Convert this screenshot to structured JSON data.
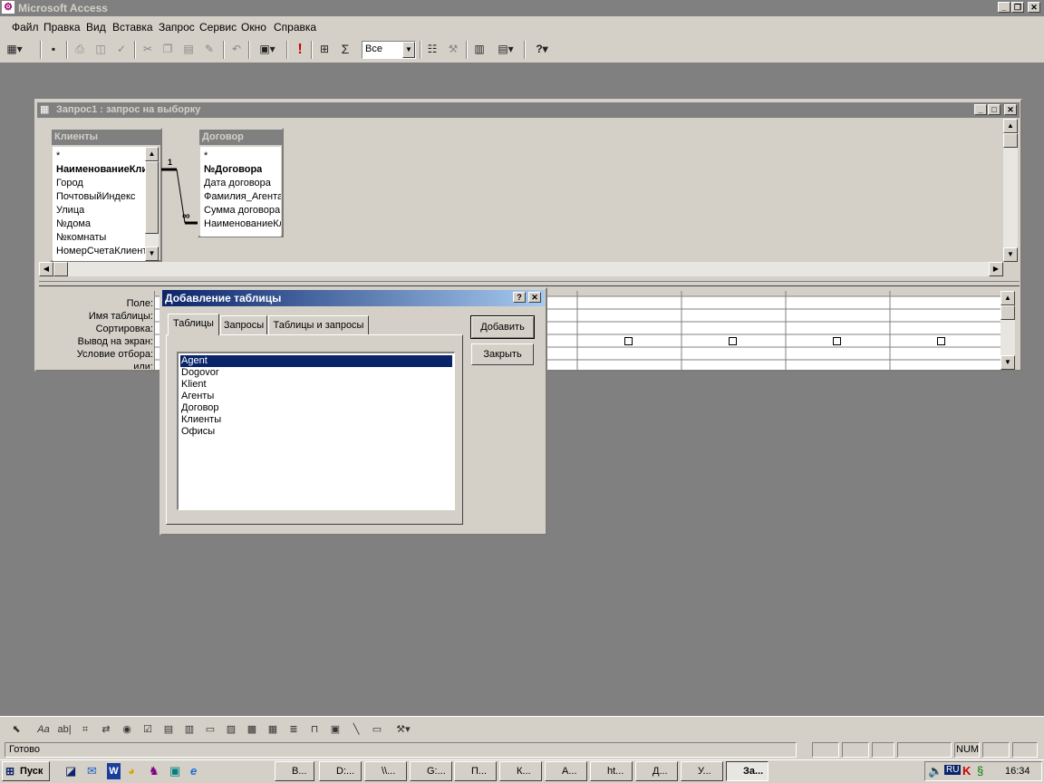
{
  "app": {
    "title": "Microsoft Access"
  },
  "menu": [
    "Файл",
    "Правка",
    "Вид",
    "Вставка",
    "Запрос",
    "Сервис",
    "Окно",
    "Справка"
  ],
  "toolbar": {
    "top_values_value": "Все",
    "sigma": "Σ",
    "run": "!"
  },
  "query_window": {
    "title": "Запрос1 : запрос на выборку",
    "tables": [
      {
        "title": "Клиенты",
        "fields": [
          "*",
          "НаименованиеКлиента",
          "Город",
          "ПочтовыйИндекс",
          "Улица",
          "№дома",
          "№комнаты",
          "НомерСчетаКлиента"
        ]
      },
      {
        "title": "Договор",
        "fields": [
          "*",
          "№Договора",
          "Дата договора",
          "Фамилия_Агента",
          "Сумма договора",
          "НаименованиеКлиента"
        ]
      }
    ],
    "relation": {
      "one": "1",
      "many": "∞"
    },
    "grid_labels": [
      "Поле:",
      "Имя таблицы:",
      "Сортировка:",
      "Вывод на экран:",
      "Условие отбора:",
      "или:"
    ]
  },
  "dialog": {
    "title": "Добавление таблицы",
    "tabs": [
      "Таблицы",
      "Запросы",
      "Таблицы и запросы"
    ],
    "active_tab": "Таблицы",
    "items": [
      "Agent",
      "Dogovor",
      "Klient",
      "Агенты",
      "Договор",
      "Клиенты",
      "Офисы"
    ],
    "selected_item": "Agent",
    "buttons": {
      "add": "Добавить",
      "close": "Закрыть"
    },
    "help_glyph": "?",
    "close_glyph": "✕"
  },
  "status": {
    "text": "Готово",
    "num": "NUM"
  },
  "taskbar": {
    "start": "Пуск",
    "tasks": [
      "В...",
      "D:...",
      "\\\\...",
      "G:...",
      "П...",
      "К...",
      "А...",
      "ht...",
      "Д...",
      "У...",
      "За..."
    ],
    "lang": "RU",
    "clock": "16:34"
  },
  "colors": {
    "titlebar": "#0a246a",
    "titlebar_end": "#a6caf0",
    "inactive_title": "#808080",
    "face": "#d4d0c8",
    "desktop_mdi": "#808080"
  }
}
